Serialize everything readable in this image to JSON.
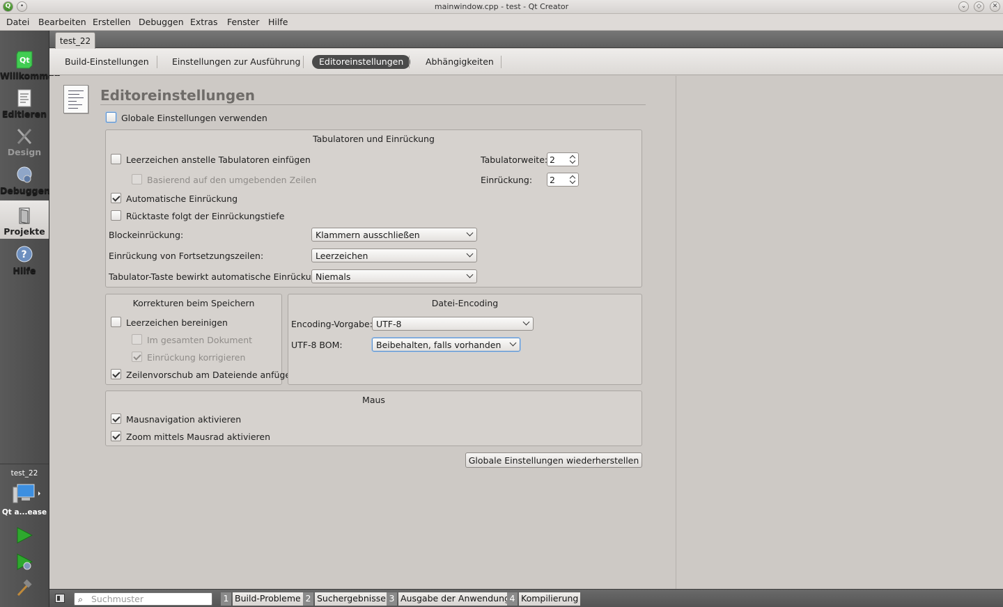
{
  "window": {
    "title": "mainwindow.cpp - test - Qt Creator"
  },
  "menu": [
    "Datei",
    "Bearbeiten",
    "Erstellen",
    "Debuggen",
    "Extras",
    "Fenster",
    "Hilfe"
  ],
  "modes": {
    "welcome": "Willkommen",
    "edit": "Editieren",
    "design": "Design",
    "debug": "Debuggen",
    "projects": "Projekte",
    "help": "Hilfe"
  },
  "project_tab": "test_22",
  "subtabs": [
    "Build-Einstellungen",
    "Einstellungen zur Ausführung",
    "Editoreinstellungen",
    "Abhängigkeiten"
  ],
  "page": {
    "title": "Editoreinstellungen",
    "use_global": "Globale Einstellungen verwenden"
  },
  "tabs_group": {
    "title": "Tabulatoren und Einrückung",
    "spaces_instead_tabs": "Leerzeichen anstelle Tabulatoren einfügen",
    "based_on_surrounding": "Basierend auf den umgebenden Zeilen",
    "auto_indent": "Automatische Einrückung",
    "backspace_follows": "Rücktaste folgt der Einrückungstiefe",
    "tab_width_label": "Tabulatorweite:",
    "tab_width_value": "2",
    "indent_label": "Einrückung:",
    "indent_value": "2",
    "block_indent_label": "Blockeinrückung:",
    "block_indent_value": "Klammern ausschließen",
    "continuation_label": "Einrückung von Fortsetzungszeilen:",
    "continuation_value": "Leerzeichen",
    "tab_key_label": "Tabulator-Taste bewirkt automatische Einrückung:",
    "tab_key_value": "Niemals"
  },
  "cleanup_group": {
    "title": "Korrekturen beim Speichern",
    "clean_whitespace": "Leerzeichen bereinigen",
    "entire_document": "Im gesamten Dokument",
    "clean_indentation": "Einrückung korrigieren",
    "newline_at_end": "Zeilenvorschub am Dateiende anfügen"
  },
  "encoding_group": {
    "title": "Datei-Encoding",
    "default_label": "Encoding-Vorgabe:",
    "default_value": "UTF-8",
    "bom_label": "UTF-8 BOM:",
    "bom_value": "Beibehalten, falls vorhanden"
  },
  "mouse_group": {
    "title": "Maus",
    "mouse_navigation": "Mausnavigation aktivieren",
    "wheel_zoom": "Zoom mittels Mausrad aktivieren"
  },
  "restore_button": "Globale Einstellungen wiederherstellen",
  "kit": {
    "project": "test_22",
    "name": "Qt a...ease"
  },
  "statusbar": {
    "search_placeholder": "Suchmuster",
    "panes": [
      {
        "num": "1",
        "label": "Build-Probleme"
      },
      {
        "num": "2",
        "label": "Suchergebnisse"
      },
      {
        "num": "3",
        "label": "Ausgabe der Anwendung"
      },
      {
        "num": "4",
        "label": "Kompilierung"
      }
    ]
  },
  "colors": {
    "active_tab": "#4a4a4a",
    "modebar": "#4f4f4f",
    "run_green": "#2ea82e"
  }
}
